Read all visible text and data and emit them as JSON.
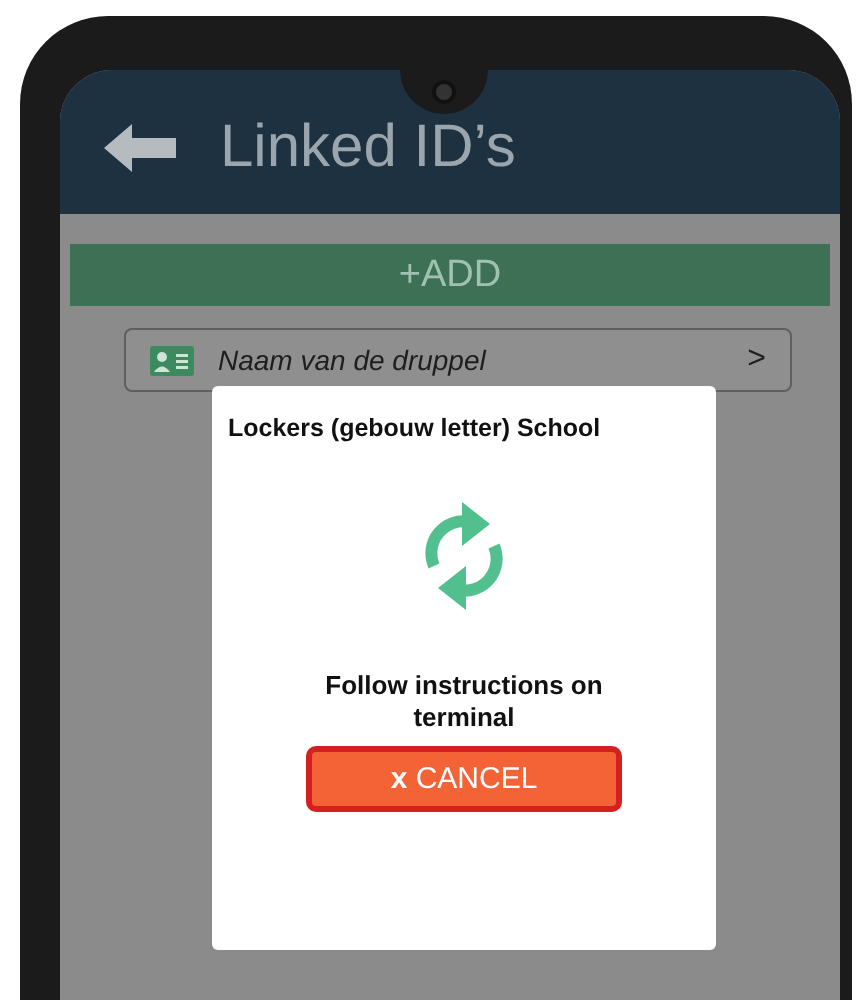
{
  "header": {
    "title": "Linked ID’s"
  },
  "add_button": "+ADD",
  "items": [
    {
      "label": "Naam van de druppel",
      "chevron": ">"
    }
  ],
  "dialog": {
    "title": "Lockers (gebouw letter) School",
    "message": "Follow instructions on terminal",
    "cancel_button": "**x** CANCEL"
  }
}
